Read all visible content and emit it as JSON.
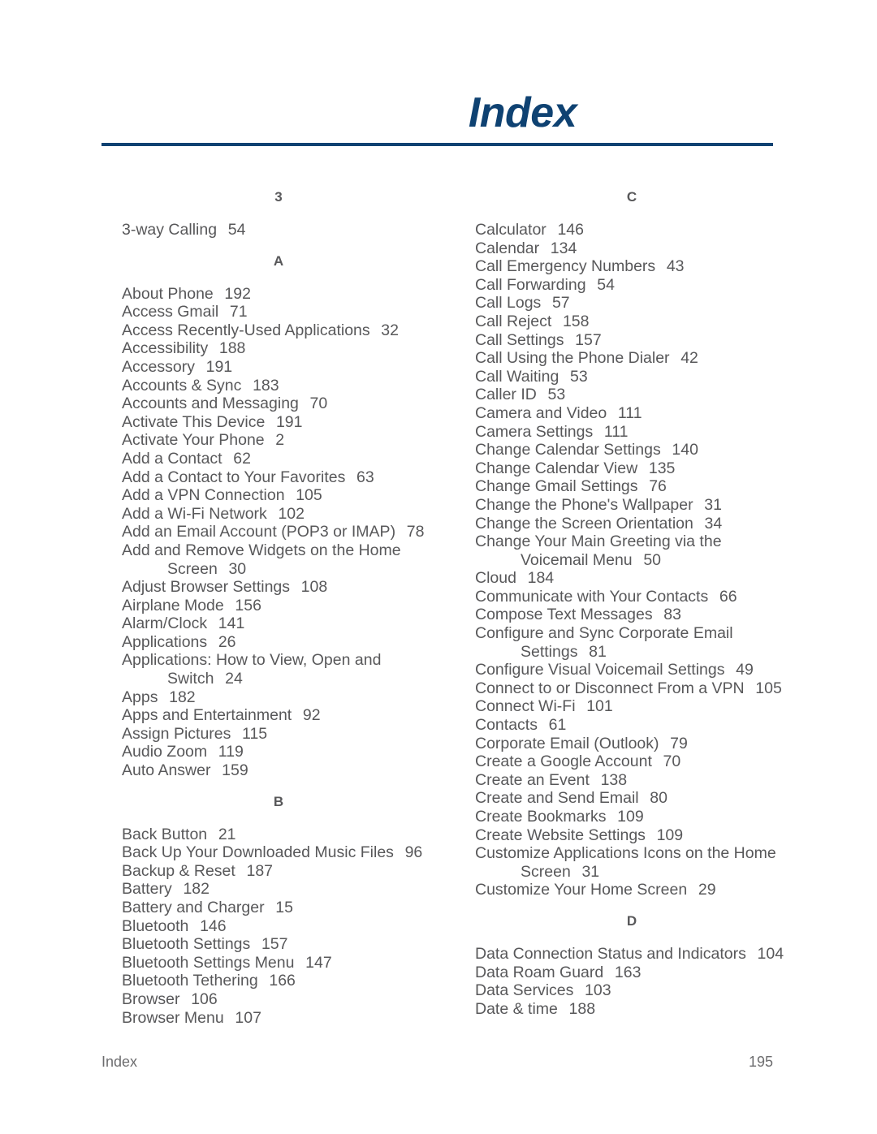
{
  "document": {
    "title": "Index",
    "accent_color": "#0f4272",
    "text_color": "#58585a"
  },
  "footer": {
    "label": "Index",
    "page_number": "195"
  },
  "columns": [
    {
      "id": "left",
      "groups": [
        {
          "letter": "3",
          "entries": [
            {
              "title": "3-way Calling",
              "page": "54"
            }
          ]
        },
        {
          "letter": "A",
          "entries": [
            {
              "title": "About Phone",
              "page": "192"
            },
            {
              "title": "Access Gmail",
              "page": "71"
            },
            {
              "title": "Access Recently-Used Applications",
              "page": "32"
            },
            {
              "title": "Accessibility",
              "page": "188"
            },
            {
              "title": "Accessory",
              "page": "191"
            },
            {
              "title": "Accounts & Sync",
              "page": "183"
            },
            {
              "title": "Accounts and Messaging",
              "page": "70"
            },
            {
              "title": "Activate This Device",
              "page": "191"
            },
            {
              "title": "Activate Your Phone",
              "page": "2"
            },
            {
              "title": "Add a Contact",
              "page": "62"
            },
            {
              "title": "Add a Contact to Your Favorites",
              "page": "63"
            },
            {
              "title": "Add a VPN Connection",
              "page": "105"
            },
            {
              "title": "Add a Wi-Fi Network",
              "page": "102"
            },
            {
              "title": "Add an Email Account (POP3 or IMAP)",
              "page": "78"
            },
            {
              "title": "Add and Remove Widgets on the Home",
              "continuation": "Screen",
              "page": "30"
            },
            {
              "title": "Adjust Browser Settings",
              "page": "108"
            },
            {
              "title": "Airplane Mode",
              "page": "156"
            },
            {
              "title": "Alarm/Clock",
              "page": "141"
            },
            {
              "title": "Applications",
              "page": "26"
            },
            {
              "title": "Applications: How to View, Open and",
              "continuation": "Switch",
              "page": "24"
            },
            {
              "title": "Apps",
              "page": "182"
            },
            {
              "title": "Apps and Entertainment",
              "page": "92"
            },
            {
              "title": "Assign Pictures",
              "page": "115"
            },
            {
              "title": "Audio Zoom",
              "page": "119"
            },
            {
              "title": "Auto Answer",
              "page": "159"
            }
          ]
        },
        {
          "letter": "B",
          "entries": [
            {
              "title": "Back Button",
              "page": "21"
            },
            {
              "title": "Back Up Your Downloaded Music Files",
              "page": "96"
            },
            {
              "title": "Backup & Reset",
              "page": "187"
            },
            {
              "title": "Battery",
              "page": "182"
            },
            {
              "title": "Battery and Charger",
              "page": "15"
            },
            {
              "title": "Bluetooth",
              "page": "146"
            },
            {
              "title": "Bluetooth Settings",
              "page": "157"
            },
            {
              "title": "Bluetooth Settings Menu",
              "page": "147"
            },
            {
              "title": "Bluetooth Tethering",
              "page": "166"
            },
            {
              "title": "Browser",
              "page": "106"
            },
            {
              "title": "Browser Menu",
              "page": "107"
            }
          ]
        }
      ]
    },
    {
      "id": "right",
      "groups": [
        {
          "letter": "C",
          "entries": [
            {
              "title": "Calculator",
              "page": "146"
            },
            {
              "title": "Calendar",
              "page": "134"
            },
            {
              "title": "Call Emergency Numbers",
              "page": "43"
            },
            {
              "title": "Call Forwarding",
              "page": "54"
            },
            {
              "title": "Call Logs",
              "page": "57"
            },
            {
              "title": "Call Reject",
              "page": "158"
            },
            {
              "title": "Call Settings",
              "page": "157"
            },
            {
              "title": "Call Using the Phone Dialer",
              "page": "42"
            },
            {
              "title": "Call Waiting",
              "page": "53"
            },
            {
              "title": "Caller ID",
              "page": "53"
            },
            {
              "title": "Camera and Video",
              "page": "111"
            },
            {
              "title": "Camera Settings",
              "page": "111"
            },
            {
              "title": "Change Calendar Settings",
              "page": "140"
            },
            {
              "title": "Change Calendar View",
              "page": "135"
            },
            {
              "title": "Change Gmail Settings",
              "page": "76"
            },
            {
              "title": "Change the Phone's Wallpaper",
              "page": "31"
            },
            {
              "title": "Change the Screen Orientation",
              "page": "34"
            },
            {
              "title": "Change Your Main Greeting via the",
              "continuation": "Voicemail Menu",
              "page": "50"
            },
            {
              "title": "Cloud",
              "page": "184"
            },
            {
              "title": "Communicate with Your Contacts",
              "page": "66"
            },
            {
              "title": "Compose Text Messages",
              "page": "83"
            },
            {
              "title": "Configure and Sync Corporate Email",
              "continuation": "Settings",
              "page": "81"
            },
            {
              "title": "Configure Visual Voicemail Settings",
              "page": "49"
            },
            {
              "title": "Connect to or Disconnect From a VPN",
              "page": "105"
            },
            {
              "title": "Connect Wi-Fi",
              "page": "101"
            },
            {
              "title": "Contacts",
              "page": "61"
            },
            {
              "title": "Corporate Email (Outlook)",
              "page": "79"
            },
            {
              "title": "Create a Google Account",
              "page": "70"
            },
            {
              "title": "Create an Event",
              "page": "138"
            },
            {
              "title": "Create and Send Email",
              "page": "80"
            },
            {
              "title": "Create Bookmarks",
              "page": "109"
            },
            {
              "title": "Create Website Settings",
              "page": "109"
            },
            {
              "title": "Customize Applications Icons on the Home",
              "continuation": "Screen",
              "page": "31"
            },
            {
              "title": "Customize Your Home Screen",
              "page": "29"
            }
          ]
        },
        {
          "letter": "D",
          "entries": [
            {
              "title": "Data Connection Status and Indicators",
              "page": "104"
            },
            {
              "title": "Data Roam Guard",
              "page": "163"
            },
            {
              "title": "Data Services",
              "page": "103"
            },
            {
              "title": "Date & time",
              "page": "188"
            }
          ]
        }
      ]
    }
  ]
}
